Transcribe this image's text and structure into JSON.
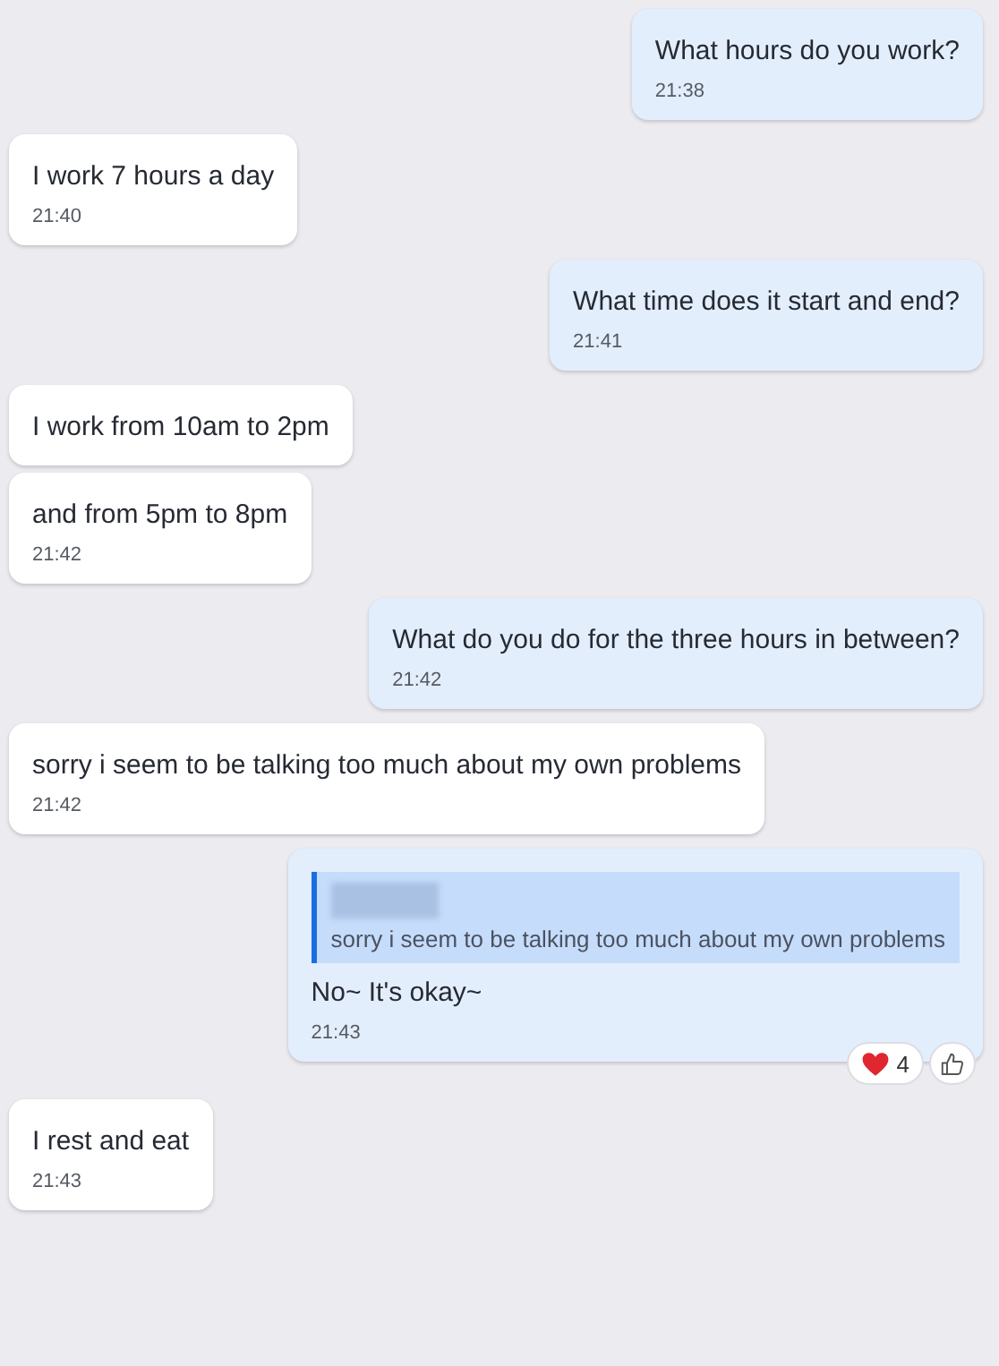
{
  "messages": [
    {
      "kind": "sent",
      "text": "What hours do you work?",
      "time": "21:38"
    },
    {
      "kind": "received",
      "text": "I work 7 hours a day",
      "time": "21:40"
    },
    {
      "kind": "sent",
      "text": "What time does it start and end?",
      "time": "21:41"
    },
    {
      "kind": "received",
      "text": "I work from 10am to 2pm"
    },
    {
      "kind": "received",
      "text": "and from 5pm to 8pm",
      "time": "21:42"
    },
    {
      "kind": "sent",
      "text": "What do you do for the three hours in between?",
      "time": "21:42"
    },
    {
      "kind": "received",
      "text": "sorry i seem to be talking too much about my own problems",
      "time": "21:42"
    },
    {
      "kind": "sent",
      "reply_to": {
        "text": "sorry i seem to be talking too much about my own problems"
      },
      "text": "No~ It's okay~",
      "time": "21:43",
      "reactions": [
        {
          "kind": "heart",
          "count": "4"
        },
        {
          "kind": "like"
        }
      ]
    },
    {
      "kind": "received",
      "text": "I rest and eat",
      "time": "21:43"
    }
  ]
}
